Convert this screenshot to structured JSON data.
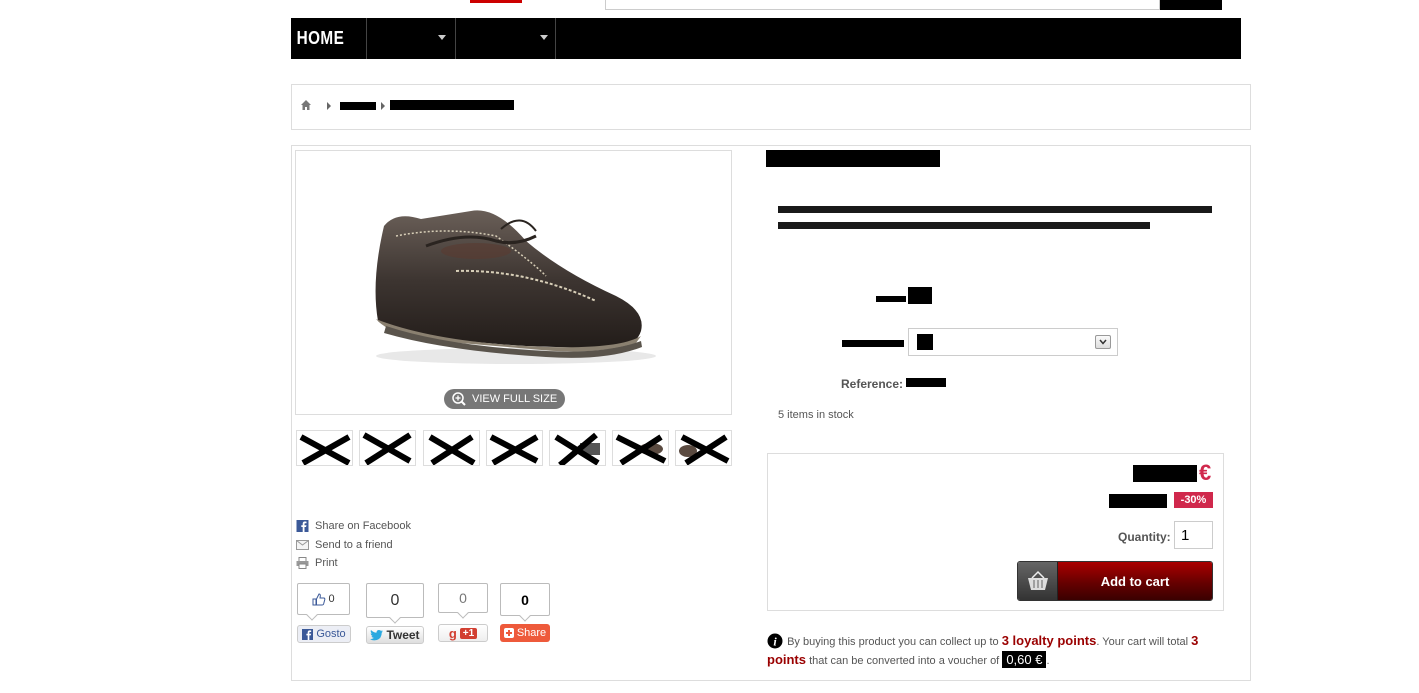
{
  "nav": {
    "home_label": "HOME"
  },
  "product": {
    "view_full_size": "VIEW FULL SIZE",
    "reference_label": "Reference:",
    "stock": "5 items in stock",
    "price_currency": "€",
    "discount": "-30%",
    "quantity_label": "Quantity:",
    "quantity_value": "1",
    "add_to_cart": "Add to cart"
  },
  "share": {
    "facebook": "Share on Facebook",
    "friend": "Send to a friend",
    "print": "Print"
  },
  "social": {
    "like_count": "0",
    "like_label": "Gosto",
    "tweet_count": "0",
    "tweet_label": "Tweet",
    "gplus_count": "0",
    "gplus_label": "+1",
    "share_count": "0",
    "share_label": "Share"
  },
  "loyalty": {
    "text1": "By buying this product you can collect up to",
    "points": "3 loyalty points",
    "text2": ". Your cart will total",
    "total_points": "3 points",
    "text3": "that can be converted into a voucher of",
    "voucher": "0,60 €"
  },
  "colors": {
    "accent_red": "#9a0000",
    "discount_pink": "#d0284c",
    "nav_bg": "#000000"
  }
}
